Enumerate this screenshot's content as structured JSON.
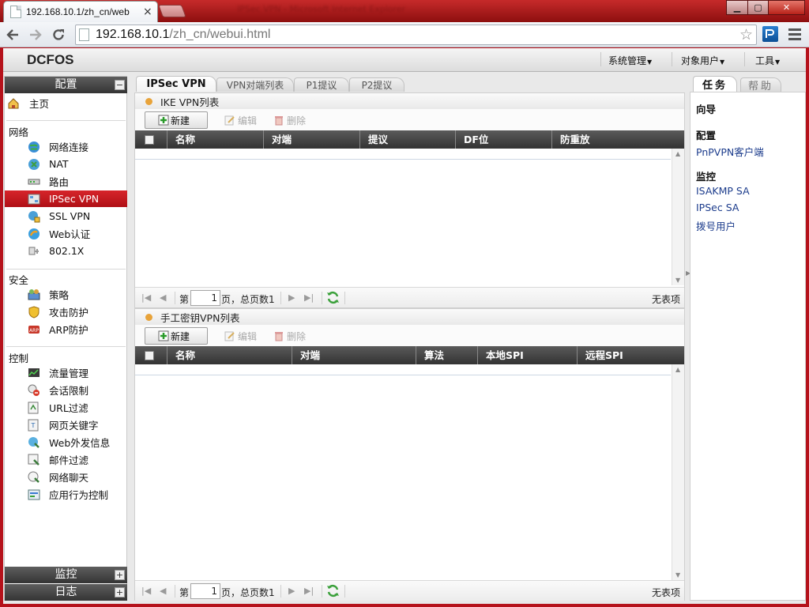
{
  "browser": {
    "tab_title": "192.168.10.1/zh_cn/web",
    "tab_close": "×",
    "url_host": "192.168.10.1",
    "url_path": "/zh_cn/webui.html",
    "blurred_title": "IPSec VPN - Microsoft Internet Explorer"
  },
  "header": {
    "logo": "DCFOS",
    "menus": [
      {
        "label": "系统管理"
      },
      {
        "label": "对象用户"
      },
      {
        "label": "工具"
      }
    ]
  },
  "sidebar": {
    "config_title": "配置",
    "home": "主页",
    "sections": [
      {
        "title": "网络",
        "items": [
          "网络连接",
          "NAT",
          "路由",
          "IPSec VPN",
          "SSL VPN",
          "Web认证",
          "802.1X"
        ]
      },
      {
        "title": "安全",
        "items": [
          "策略",
          "攻击防护",
          "ARP防护"
        ]
      },
      {
        "title": "控制",
        "items": [
          "流量管理",
          "会话限制",
          "URL过滤",
          "网页关键字",
          "Web外发信息",
          "邮件过滤",
          "网络聊天",
          "应用行为控制"
        ]
      }
    ],
    "active_item": "IPSec VPN",
    "monitor_title": "监控",
    "log_title": "日志"
  },
  "center": {
    "tabs": [
      "IPSec VPN",
      "VPN对端列表",
      "P1提议",
      "P2提议"
    ],
    "ike_panel": {
      "title": "IKE VPN列表",
      "columns": [
        "名称",
        "对端",
        "提议",
        "DF位",
        "防重放"
      ]
    },
    "manual_panel": {
      "title": "手工密钥VPN列表",
      "columns": [
        "名称",
        "对端",
        "算法",
        "本地SPI",
        "远程SPI"
      ]
    },
    "toolbar": {
      "new": "新建",
      "edit": "编辑",
      "delete": "删除"
    },
    "pager": {
      "page_prefix": "第",
      "page_value": "1",
      "page_suffix": "页，总页数1",
      "no_items": "无表项"
    }
  },
  "right_panel": {
    "tabs": [
      "任务",
      "帮助"
    ],
    "wizard": "向导",
    "config": "配置",
    "config_links": [
      "PnPVPN客户端"
    ],
    "monitor": "监控",
    "monitor_links": [
      "ISAKMP SA",
      "IPSec SA",
      "拨号用户"
    ]
  },
  "colors": {
    "accent_red": "#b5121b",
    "active_item": "#c81a20",
    "link_blue": "#1c3c8c",
    "grid_header": "#3a3a3a"
  }
}
